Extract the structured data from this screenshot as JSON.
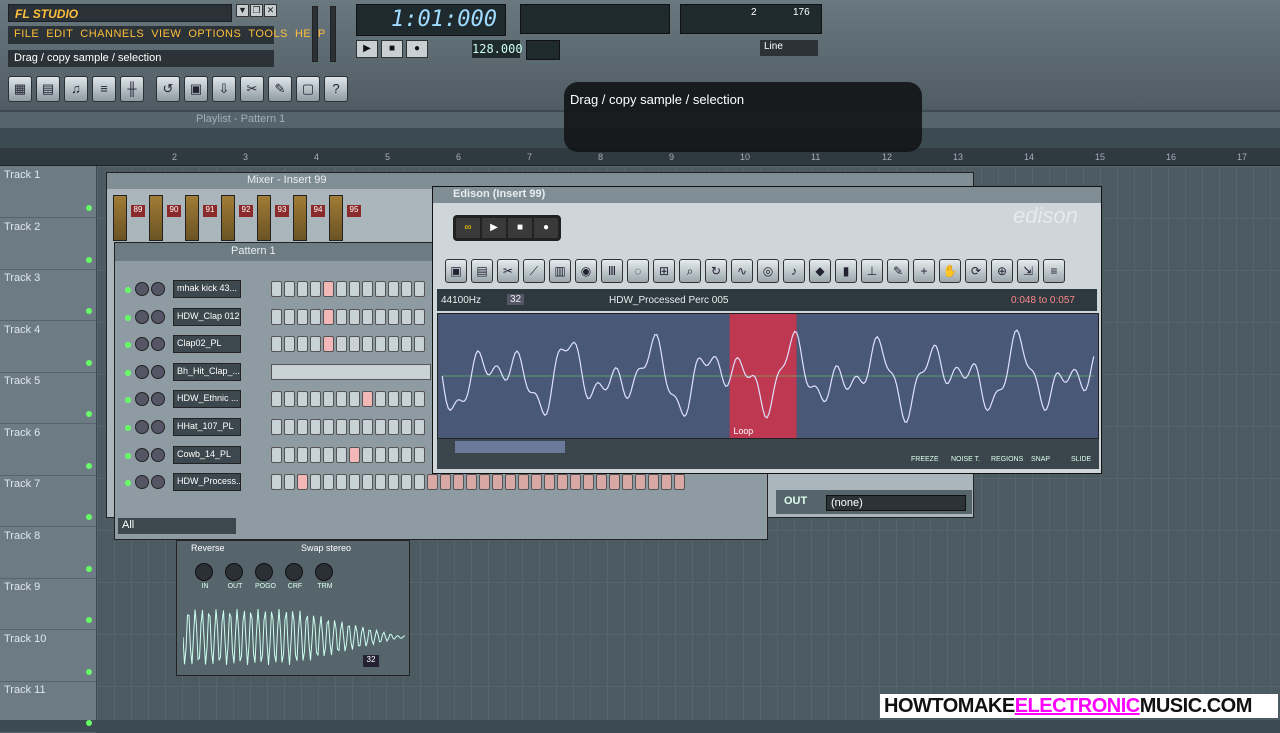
{
  "app": {
    "name": "FL STUDIO",
    "menus": [
      "FILE",
      "EDIT",
      "CHANNELS",
      "VIEW",
      "OPTIONS",
      "TOOLS",
      "HELP"
    ],
    "hint_bar": "Drag / copy sample / selection"
  },
  "transport": {
    "time": "1:01:000",
    "tempo": "128.000",
    "line_mode": "Line",
    "cpu": "2",
    "poly": "176"
  },
  "playlist": {
    "title": "Playlist - Pattern 1",
    "ruler": [
      "2",
      "3",
      "4",
      "5",
      "6",
      "7",
      "8",
      "9",
      "10",
      "11",
      "12",
      "13",
      "14",
      "15",
      "16",
      "17"
    ],
    "tracks": [
      "Track 1",
      "Track 2",
      "Track 3",
      "Track 4",
      "Track 5",
      "Track 6",
      "Track 7",
      "Track 8",
      "Track 9",
      "Track 10",
      "Track 11"
    ]
  },
  "mixer": {
    "title": "Mixer - Insert 99",
    "inserts": [
      "89",
      "90",
      "91",
      "92",
      "93",
      "94",
      "95"
    ],
    "out_label": "OUT",
    "out_value": "(none)"
  },
  "pattern": {
    "title": "Pattern 1",
    "filter": "All",
    "channels": [
      "mhak kick 43...",
      "HDW_Clap 012",
      "Clap02_PL",
      "Bh_Hit_Clap_...",
      "HDW_Ethnic ...",
      "HHat_107_PL",
      "Cowb_14_PL",
      "HDW_Process..."
    ]
  },
  "sampler": {
    "reverse": "Reverse",
    "swap": "Swap stereo",
    "knobs": [
      "IN",
      "OUT",
      "POGO",
      "CRF",
      "TRM"
    ],
    "bits": "32"
  },
  "edison": {
    "title": "Edison (Insert 99)",
    "logo": "edison",
    "samplerate": "44100Hz",
    "format": "32",
    "title_field": "HDW_Processed Perc 005",
    "range": "0:048 to 0:057",
    "region_label": "Loop",
    "bottom_opts": [
      "FREEZE",
      "NOISE T.",
      "REGIONS",
      "SNAP",
      "SLIDE"
    ]
  },
  "tooltip": {
    "text": "Drag / copy sample / selection"
  },
  "watermark": {
    "pre": "HOWTOMAKE",
    "hi": "ELECTRONIC",
    "post": "MUSIC.COM"
  }
}
